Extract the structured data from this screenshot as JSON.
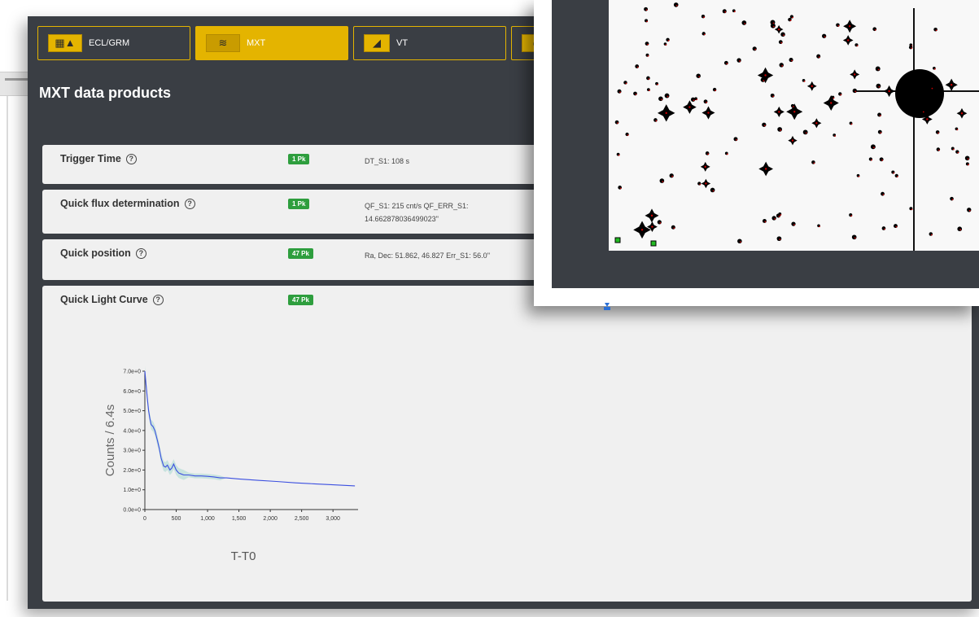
{
  "tabs": [
    {
      "label": "ECL/GRM",
      "icon": "ecl-grm-icon",
      "active": false
    },
    {
      "label": "MXT",
      "icon": "mxt-icon",
      "active": true
    },
    {
      "label": "VT",
      "icon": "vt-icon",
      "active": false
    },
    {
      "label": "",
      "icon": "next-tab-icon",
      "active": false
    }
  ],
  "section": {
    "title": "MXT data products"
  },
  "products": [
    {
      "title": "Trigger Time",
      "badge": "1 Pk",
      "value_line1": "DT_S1: 108 s",
      "value_line2": ""
    },
    {
      "title": "Quick flux determination",
      "badge": "1 Pk",
      "value_line1": "QF_S1: 215 cnt/s QF_ERR_S1:",
      "value_line2": "14.662878036499023''"
    },
    {
      "title": "Quick position",
      "badge": "47 Pk",
      "value_line1": "Ra, Dec: 51.862, 46.827   Err_S1: 56.0''",
      "value_line2": ""
    },
    {
      "title": "Quick Light Curve",
      "badge": "47 Pk",
      "value_line1": "",
      "value_line2": ""
    }
  ],
  "colors": {
    "accent": "#e4b400",
    "panel": "#3a3e44",
    "badge": "#2e9e3e",
    "line": "#3b4fe0",
    "band": "#a8d8d0"
  },
  "chart_data": {
    "type": "line",
    "title": "",
    "xlabel": "T-T0",
    "ylabel": "Counts / 6.4s",
    "xlim": [
      0,
      3400
    ],
    "ylim": [
      0,
      7
    ],
    "xticks": [
      0,
      500,
      1000,
      1500,
      2000,
      2500,
      3000
    ],
    "xtick_labels": [
      "0",
      "500",
      "1,000",
      "1,500",
      "2,000",
      "2,500",
      "3,000"
    ],
    "yticks": [
      0,
      1,
      2,
      3,
      4,
      5,
      6,
      7
    ],
    "ytick_labels": [
      "0.0e+0",
      "1.0e+0",
      "2.0e+0",
      "3.0e+0",
      "4.0e+0",
      "5.0e+0",
      "6.0e+0",
      "7.0e+0"
    ],
    "grid": false,
    "series": [
      {
        "x": [
          0,
          20,
          40,
          60,
          80,
          100,
          130,
          160,
          200,
          230,
          260,
          300,
          330,
          360,
          400,
          430,
          460,
          500,
          540,
          580,
          620,
          700,
          800,
          900,
          1000,
          1100,
          1200,
          1300,
          1500,
          1800,
          2100,
          2400,
          2700,
          3000,
          3350
        ],
        "y": [
          7.0,
          6.3,
          5.6,
          5.0,
          4.6,
          4.3,
          4.2,
          4.0,
          3.5,
          3.1,
          2.6,
          2.2,
          2.15,
          2.25,
          2.0,
          2.1,
          2.3,
          2.0,
          1.85,
          1.8,
          1.75,
          1.75,
          1.7,
          1.7,
          1.68,
          1.65,
          1.6,
          1.6,
          1.55,
          1.48,
          1.42,
          1.35,
          1.3,
          1.25,
          1.2
        ]
      }
    ]
  }
}
